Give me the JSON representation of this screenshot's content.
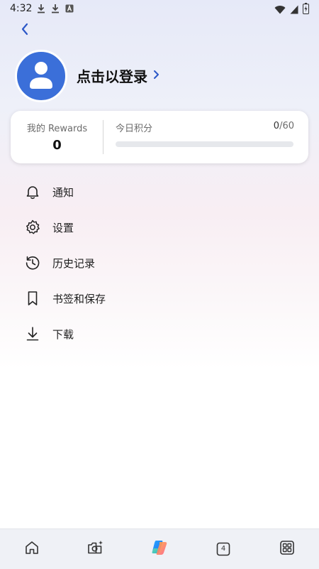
{
  "status_bar": {
    "time": "4:32",
    "left_icons": [
      "download-icon",
      "download-icon",
      "font-icon"
    ],
    "right_icons": [
      "wifi-icon",
      "signal-icon",
      "battery-charging-icon"
    ]
  },
  "header": {
    "back_icon": "chevron-left-icon"
  },
  "profile": {
    "avatar_icon": "person-icon",
    "login_text": "点击以登录",
    "login_chevron": "chevron-right-icon"
  },
  "rewards": {
    "label": "我的 Rewards",
    "value": "0",
    "points_label": "今日积分",
    "points_current": "0",
    "points_total": "/60",
    "progress_fraction": 0
  },
  "menu": [
    {
      "icon": "bell-icon",
      "label": "通知"
    },
    {
      "icon": "gear-icon",
      "label": "设置"
    },
    {
      "icon": "history-icon",
      "label": "历史记录"
    },
    {
      "icon": "bookmark-icon",
      "label": "书签和保存"
    },
    {
      "icon": "download-icon",
      "label": "下载"
    }
  ],
  "bottom_nav": {
    "items": [
      {
        "icon": "home-icon"
      },
      {
        "icon": "camera-sparkle-icon"
      },
      {
        "icon": "copilot-icon"
      },
      {
        "icon": "tabs-icon",
        "count": "4"
      },
      {
        "icon": "apps-grid-icon"
      }
    ]
  },
  "colors": {
    "accent": "#3b6fd9",
    "back_chevron": "#2b57c7"
  }
}
